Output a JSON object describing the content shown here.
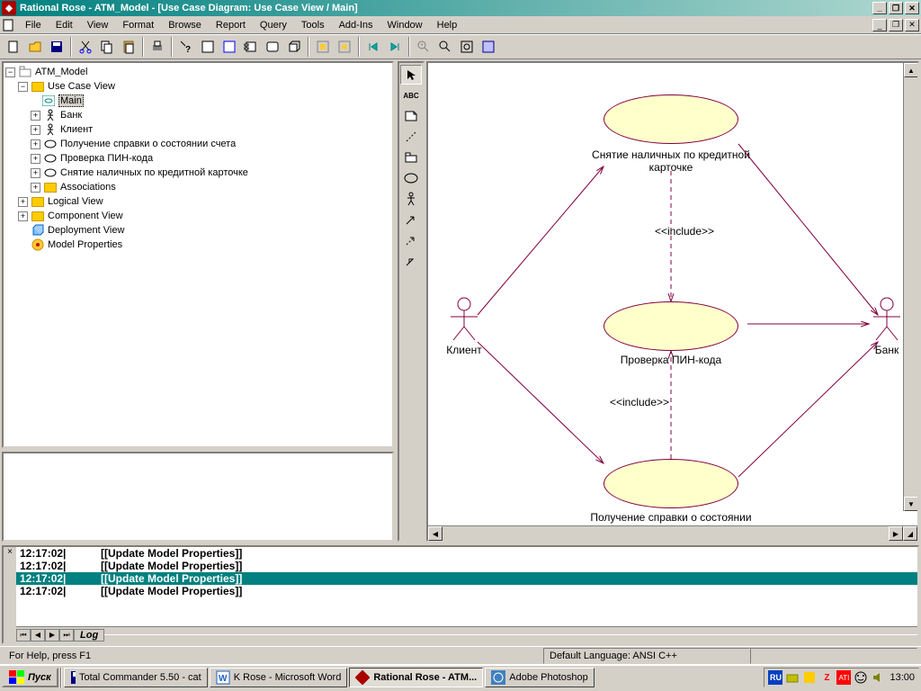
{
  "title": "Rational Rose - ATM_Model - [Use Case Diagram: Use Case View / Main]",
  "menu": [
    "File",
    "Edit",
    "View",
    "Format",
    "Browse",
    "Report",
    "Query",
    "Tools",
    "Add-Ins",
    "Window",
    "Help"
  ],
  "tree": {
    "root": "ATM_Model",
    "ucv": "Use Case View",
    "main": "Main",
    "bank": "Банк",
    "client": "Клиент",
    "uc1": "Получение справки о состоянии счета",
    "uc2": "Проверка ПИН-кода",
    "uc3": "Снятие наличных по кредитной карточке",
    "assoc": "Associations",
    "lv": "Logical View",
    "cv": "Component View",
    "dv": "Deployment View",
    "mp": "Model Properties"
  },
  "diagram": {
    "actor1": "Клиент",
    "actor2": "Банк",
    "uc_top": "Снятие наличных по кредитной карточке",
    "uc_mid": "Проверка ПИН-кода",
    "uc_bot": "Получение справки о состоянии счета",
    "include": "<<include>>"
  },
  "log": {
    "rows": [
      {
        "t": "12:17:02|",
        "m": "[[Update Model Properties]]"
      },
      {
        "t": "12:17:02|",
        "m": "[[Update Model Properties]]"
      },
      {
        "t": "12:17:02|",
        "m": "[[Update Model Properties]]"
      },
      {
        "t": "12:17:02|",
        "m": "[[Update Model Properties]]"
      }
    ],
    "tab": "Log"
  },
  "status": {
    "help": "For Help, press F1",
    "lang": "Default Language: ANSI C++"
  },
  "taskbar": {
    "start": "Пуск",
    "tasks": [
      "Total Commander 5.50 - cat",
      "K Rose - Microsoft Word",
      "Rational Rose - ATM...",
      "Adobe Photoshop"
    ],
    "lang_ind": "RU",
    "clock": "13:00"
  }
}
